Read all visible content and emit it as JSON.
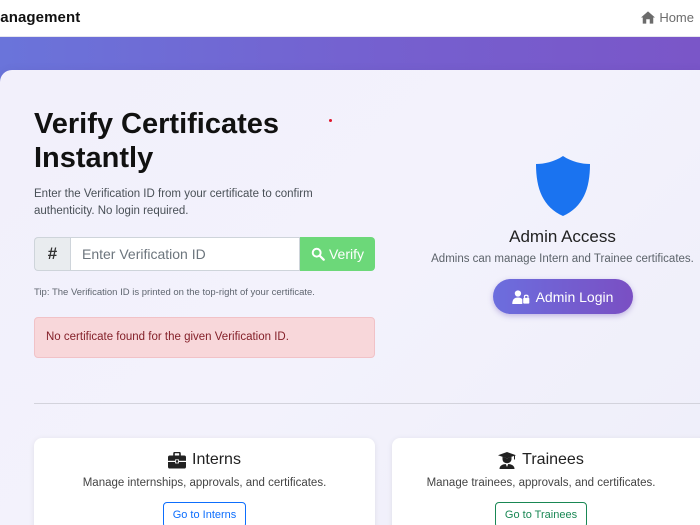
{
  "navbar": {
    "brand": "lanagement",
    "home_label": "Home"
  },
  "hero": {
    "title": "Verify Certificates Instantly",
    "lead": "Enter the Verification ID from your certificate to confirm authenticity. No login required."
  },
  "verify_form": {
    "addon": "#",
    "placeholder": "Enter Verification ID",
    "value": "",
    "button_label": "Verify",
    "tip": "Tip: The Verification ID is printed on the top-right of your certificate."
  },
  "alert": {
    "message": "No certificate found for the given Verification ID.",
    "type": "danger"
  },
  "admin": {
    "icon": "shield-icon",
    "title": "Admin Access",
    "subtitle": "Admins can manage Intern and Trainee certificates.",
    "button_label": "Admin Login"
  },
  "features": [
    {
      "icon": "briefcase-icon",
      "title": "Interns",
      "description": "Manage internships, approvals, and certificates.",
      "button_label": "Go to Interns"
    },
    {
      "icon": "graduate-icon",
      "title": "Trainees",
      "description": "Manage trainees, approvals, and certificates.",
      "button_label": "Go to Trainees"
    }
  ],
  "colors": {
    "accent_gradient": [
      "#6a74da",
      "#7a56c8"
    ],
    "verify_button": "#6cd879",
    "shield": "#1a73f0",
    "alert_bg": "#f8d7da",
    "alert_text": "#842029",
    "interns_button": "#0d6efd",
    "trainees_button": "#198754"
  }
}
